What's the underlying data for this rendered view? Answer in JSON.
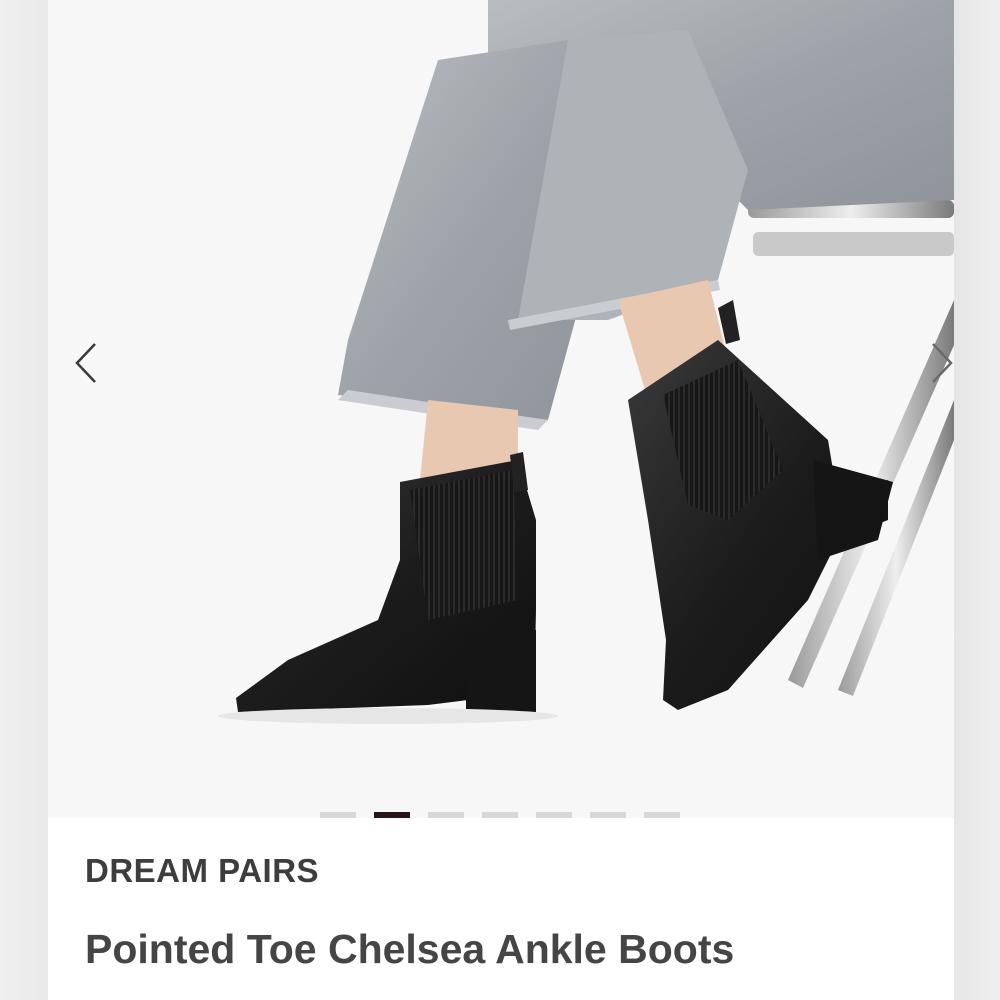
{
  "gallery": {
    "image_alt": "Model wearing black pointed toe Chelsea ankle boots with light grey frayed jeans",
    "prev_icon": "chevron-left-icon",
    "next_icon": "chevron-right-icon",
    "slide_count": 7,
    "active_slide": 2
  },
  "product": {
    "brand": "DREAM PAIRS",
    "title": "Pointed Toe Chelsea Ankle Boots"
  },
  "colors": {
    "active_dot": "#2a1418",
    "inactive_dot": "#d8d8d8",
    "text": "#3d3d3d"
  }
}
